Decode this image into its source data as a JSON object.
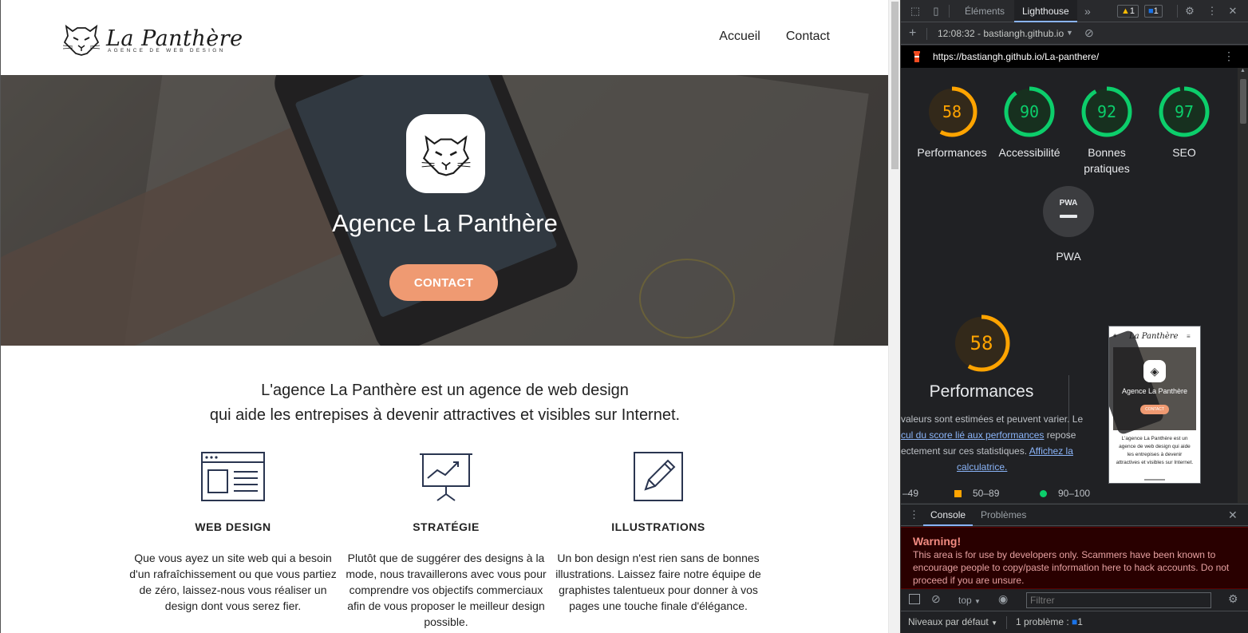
{
  "site": {
    "logo": {
      "name": "La Panthère",
      "tagline": "AGENCE DE WEB DESIGN"
    },
    "nav": [
      "Accueil",
      "Contact"
    ],
    "hero": {
      "title": "Agence La Panthère",
      "cta": "CONTACT"
    },
    "intro": {
      "line1": "L'agence La Panthère est un agence de web design",
      "line2": "qui aide les entrepises à devenir attractives et visibles sur Internet."
    },
    "services": [
      {
        "title": "WEB DESIGN",
        "text": "Que vous ayez un site web qui a besoin d'un rafraîchissement ou que vous partiez de zéro, laissez-nous vous réaliser un design dont vous serez fier."
      },
      {
        "title": "STRATÉGIE",
        "text": "Plutôt que de suggérer des designs à la mode, nous travaillerons avec vous pour comprendre vos objectifs commerciaux afin de vous proposer le meilleur design possible."
      },
      {
        "title": "ILLUSTRATIONS",
        "text": "Un bon design n'est rien sans de bonnes illustrations. Laissez faire notre équipe de graphistes talentueux pour donner à vos pages une touche finale d'élégance."
      }
    ]
  },
  "devtools": {
    "tabs": {
      "elements": "Éléments",
      "lighthouse": "Lighthouse",
      "more": "»"
    },
    "badges": {
      "warnings": "1",
      "messages": "1"
    },
    "toolbar": {
      "add": "+",
      "report": "12:08:32 - bastiangh.github.io",
      "dropdown": "▼"
    },
    "url": "https://bastiangh.github.io/La-panthere/",
    "scores": [
      {
        "value": "58",
        "label": "Performances",
        "color": "#ffa400"
      },
      {
        "value": "90",
        "label": "Accessibilité",
        "color": "#0cce6b"
      },
      {
        "value": "92",
        "label": "Bonnes pratiques",
        "color": "#0cce6b"
      },
      {
        "value": "97",
        "label": "SEO",
        "color": "#0cce6b"
      }
    ],
    "pwa": {
      "badge": "PWA",
      "label": "PWA"
    },
    "perf": {
      "value": "58",
      "title": "Performances",
      "desc1": "valeurs sont estimées et peuvent varier. Le",
      "link1": "cul du score lié aux performances",
      "desc2": " repose",
      "desc3": "ectement sur ces statistiques. ",
      "link2": "Affichez la",
      "link3": "calculatrice.",
      "legend": [
        "–49",
        "50–89",
        "90–100"
      ]
    },
    "preview": {
      "name": "La Panthère",
      "title": "Agence La Panthère",
      "cta": "CONTACT",
      "text": "L'agence La Panthère est un agence de web design qui aide les entrepises à devenir attractives et visibles sur Internet."
    },
    "console": {
      "tabs": [
        "Console",
        "Problèmes"
      ],
      "warning_title": "Warning!",
      "warning_text": "This area is for use by developers only. Scammers have been known to encourage people to copy/paste information here to hack accounts. Do not proceed if you are unsure.",
      "context": "top",
      "filter_placeholder": "Filtrer",
      "levels": "Niveaux par défaut",
      "issues": "1 problème :",
      "issues_count": "1"
    }
  }
}
